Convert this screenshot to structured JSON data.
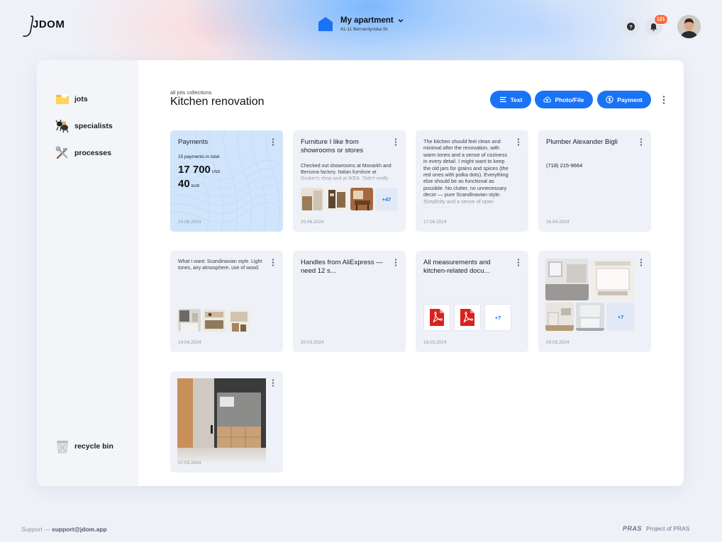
{
  "header": {
    "logo_text": "JDOM",
    "apartment_name": "My apartment",
    "apartment_address": "41-11 Bernardynska St.",
    "notifications_count": "121"
  },
  "sidebar": {
    "items": [
      {
        "label": "jots",
        "icon": "folder-icon"
      },
      {
        "label": "specialists",
        "icon": "ant-icon"
      },
      {
        "label": "processes",
        "icon": "tools-icon"
      }
    ],
    "recycle_label": "recycle bin"
  },
  "main": {
    "breadcrumb": "all jots collections",
    "title": "Kitchen renovation",
    "buttons": {
      "text": "Text",
      "photo": "Photo/File",
      "payment": "Payment"
    }
  },
  "cards": [
    {
      "type": "payments",
      "title": "Payments",
      "subtitle": "15 payments in total",
      "amount1": "17 700",
      "cur1": "USD",
      "amount2": "40",
      "cur2": "EUR",
      "date": "24.06.2024"
    },
    {
      "type": "note-images",
      "title": "Furniture I like from showrooms or stores",
      "text": "Checked out showrooms at Monarkh and Bersona factory. Italian furniture at Gruber's shop and at IKEA. Didn't really",
      "more": "+47",
      "date": "20.06.2024"
    },
    {
      "type": "text",
      "text": "The kitchen should feel clean and minimal after the renovation, with warm tones and a sense of coziness in every detail. I might want to keep the old jars for grains and spices (the red ones with polka dots). Everything else should be as functional as possible. No clutter, no unnecessary decor — pure Scandinavian style. Simplicity and a sense of open space come...",
      "date": "17.06.2024"
    },
    {
      "type": "contact",
      "title": "Plumber Alexander Bigli",
      "phone": "(718) 215-9664",
      "date": "16.04.2024"
    },
    {
      "type": "text-images",
      "text": "What I want: Scandinavian style. Light tones, airy atmosphere, use of wood.",
      "date": "14.04.2024"
    },
    {
      "type": "note",
      "title": "Handles from AliExpress — need 12 s...",
      "date": "20.03.2024"
    },
    {
      "type": "files",
      "title": "All measurements and kitchen-related docu...",
      "more": "+7",
      "date": "19.03.2024"
    },
    {
      "type": "gallery",
      "more": "+7",
      "date": "09.03.2024"
    },
    {
      "type": "photo",
      "date": "07.03.2024"
    }
  ],
  "footer": {
    "support_prefix": "Support — ",
    "support_email": "support@jdom.app",
    "pras_logo": "PRAS",
    "project_text": "Project of PRAS"
  },
  "colors": {
    "accent": "#1a73f5",
    "badge": "#ff6a3d",
    "card_bg": "#eef1f7",
    "payments_bg": "#d0e5fb"
  }
}
